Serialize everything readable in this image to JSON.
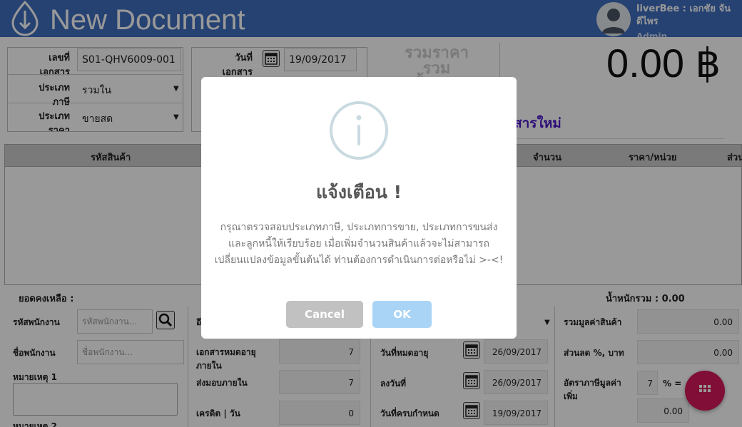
{
  "header": {
    "title": "New Document",
    "user_name": "liverBee : เอกชัย จันดีไพร",
    "user_role": "Admin"
  },
  "doc": {
    "doc_no_label": "เลขที่ เอกสาร",
    "doc_no": "S01-QHV6009-001",
    "date_label": "วันที่ เอกสาร",
    "date": "19/09/2017",
    "tax_type_label": "ประเภท ภาษี",
    "tax_type": "รวมใน",
    "price_type_label": "ประเภท ราคา",
    "price_type": "ขายสด",
    "total_caption": "รวมราคารวม ทั้งหมด",
    "total": "0.00 ฿",
    "new_doc_link": "สารใหม่"
  },
  "table": {
    "columns": [
      "รหัสสินค้า",
      "จำนวน",
      "ราคา/หน่วย",
      "ส่วน"
    ]
  },
  "footer": {
    "balance_label": "ยอดคงเหลือ :",
    "weight_label": "น้ำหนักรวม : 0.00",
    "emp_code_label": "รหัสพนักงาน",
    "emp_code_placeholder": "รหัสพนักงาน...",
    "emp_name_label": "ชื่อพนักงาน",
    "emp_name_placeholder": "ชื่อพนักงาน...",
    "note1_label": "หมายเหตุ 1",
    "note2_label": "หมายเหตุ 2",
    "col2_top_label": "อี",
    "doc_expire_label": "เอกสารหมดอายุภายใน",
    "doc_expire": "7",
    "deliver_label": "ส่งมอบภายใน",
    "deliver": "7",
    "credit_label": "เครดิต | วัน",
    "credit": "0",
    "expire_date_label": "วันที่หมดอายุ",
    "expire_date": "26/09/2017",
    "sign_date_label": "ลงวันที่",
    "sign_date": "26/09/2017",
    "due_date_label": "วันที่ครบกำหนด",
    "due_date": "19/09/2017",
    "sum_label": "รวมมูลค่าสินค้า",
    "sum": "0.00",
    "discount_label": "ส่วนลด %, บาท",
    "discount": "0.00",
    "vat_label": "อัตราภาษีมูลค่าเพิ่ม",
    "vat_rate": "7",
    "vat_pct": "% =",
    "vat": "0.00"
  },
  "modal": {
    "title": "แจ้งเตือน !",
    "message": "กรุณาตรวจสอบประเภทภาษี, ประเภทการขาย, ประเภทการขนส่งและลูกหนี้ให้เรียบร้อย เมื่อเพิ่มจำนวนสินค้าแล้วจะไม่สามารถเปลี่ยนแปลงข้อมูลขั้นต้นได้ ท่านต้องการดำเนินการต่อหรือไม่ >-<!",
    "cancel": "Cancel",
    "ok": "OK"
  },
  "colors": {
    "header": "#3f6fbf",
    "fab": "#d6185a",
    "ok": "#aad4f5",
    "cancel": "#c1c1c1",
    "link": "#4a16c8"
  },
  "icons": [
    "logo-icon",
    "avatar-icon",
    "calendar-icon",
    "search-icon",
    "caret-down-icon",
    "grid-menu-icon",
    "info-icon"
  ]
}
